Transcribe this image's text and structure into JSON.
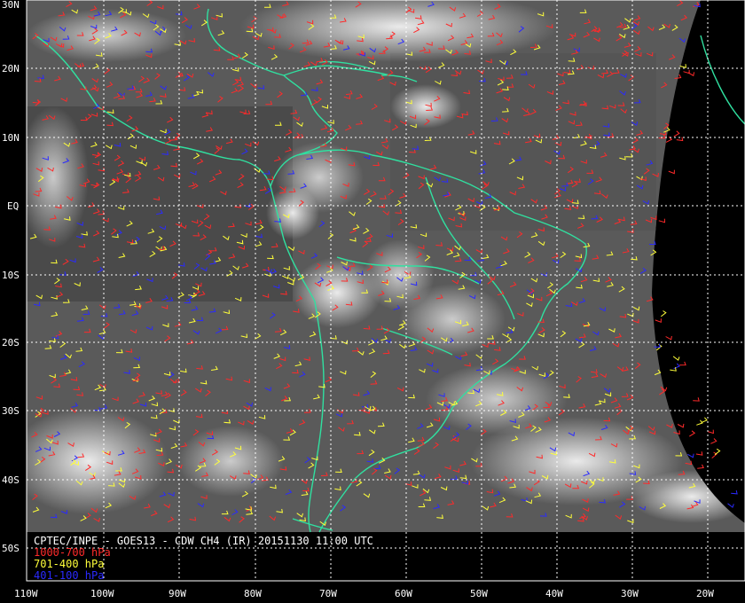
{
  "map": {
    "lat_labels": [
      "30N",
      "20N",
      "10N",
      "EQ",
      "10S",
      "20S",
      "30S",
      "40S",
      "50S"
    ],
    "lon_labels": [
      "110W",
      "100W",
      "90W",
      "80W",
      "70W",
      "60W",
      "50W",
      "40W",
      "30W",
      "20W"
    ],
    "colors": {
      "background": "#000000",
      "coast": "#30e0a0",
      "grid": "#ffffff",
      "low_level": "#ff2a2a",
      "mid_level": "#ffff3a",
      "high_level": "#2a2aff"
    }
  },
  "caption": {
    "title": "CPTEC/INPE - GOES13 - CDW CH4 (IR) 20151130 11:00 UTC",
    "legend": [
      {
        "label": "1000-700 hPa",
        "color": "#ff2a2a"
      },
      {
        "label": "701-400 hPa",
        "color": "#ffff3a"
      },
      {
        "label": "401-100 hPa",
        "color": "#2a2aff"
      }
    ]
  }
}
